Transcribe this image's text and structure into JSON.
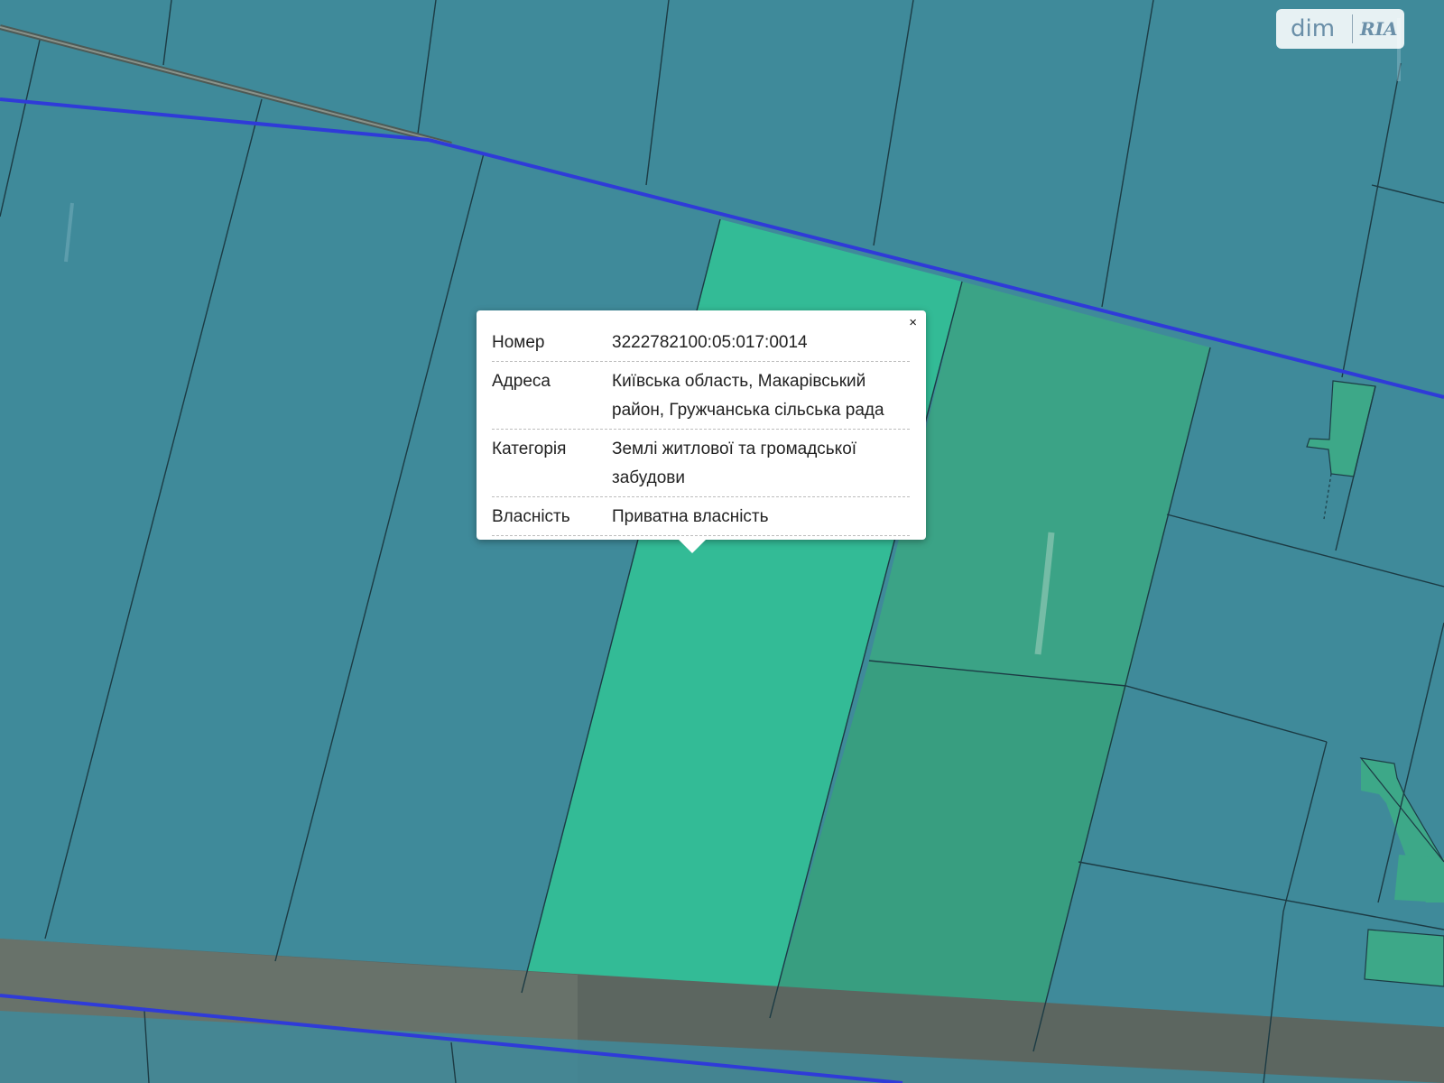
{
  "map": {
    "layers": [
      "satellite-imagery",
      "cadastral-parcels",
      "roads"
    ],
    "colors": {
      "background_parcel": "#3f8a9a",
      "selected_parcel": "#33bb96",
      "adjacent_parcel": "#3ba386",
      "boundary_line": "#1c3b44",
      "road_line": "#2f3bd8",
      "tree_strip": "#5c6660"
    }
  },
  "popup": {
    "close_label": "×",
    "rows": [
      {
        "key": "Номер",
        "value": "3222782100:05:017:0014"
      },
      {
        "key": "Адреса",
        "value": "Київська область, Макарівський район, Гружчанська сільська рада"
      },
      {
        "key": "Категорія",
        "value": "Землі житлової та громадської забудови"
      },
      {
        "key": "Власність",
        "value": "Приватна власність"
      }
    ]
  },
  "watermark": {
    "left": "dim",
    "right": "RIA"
  }
}
